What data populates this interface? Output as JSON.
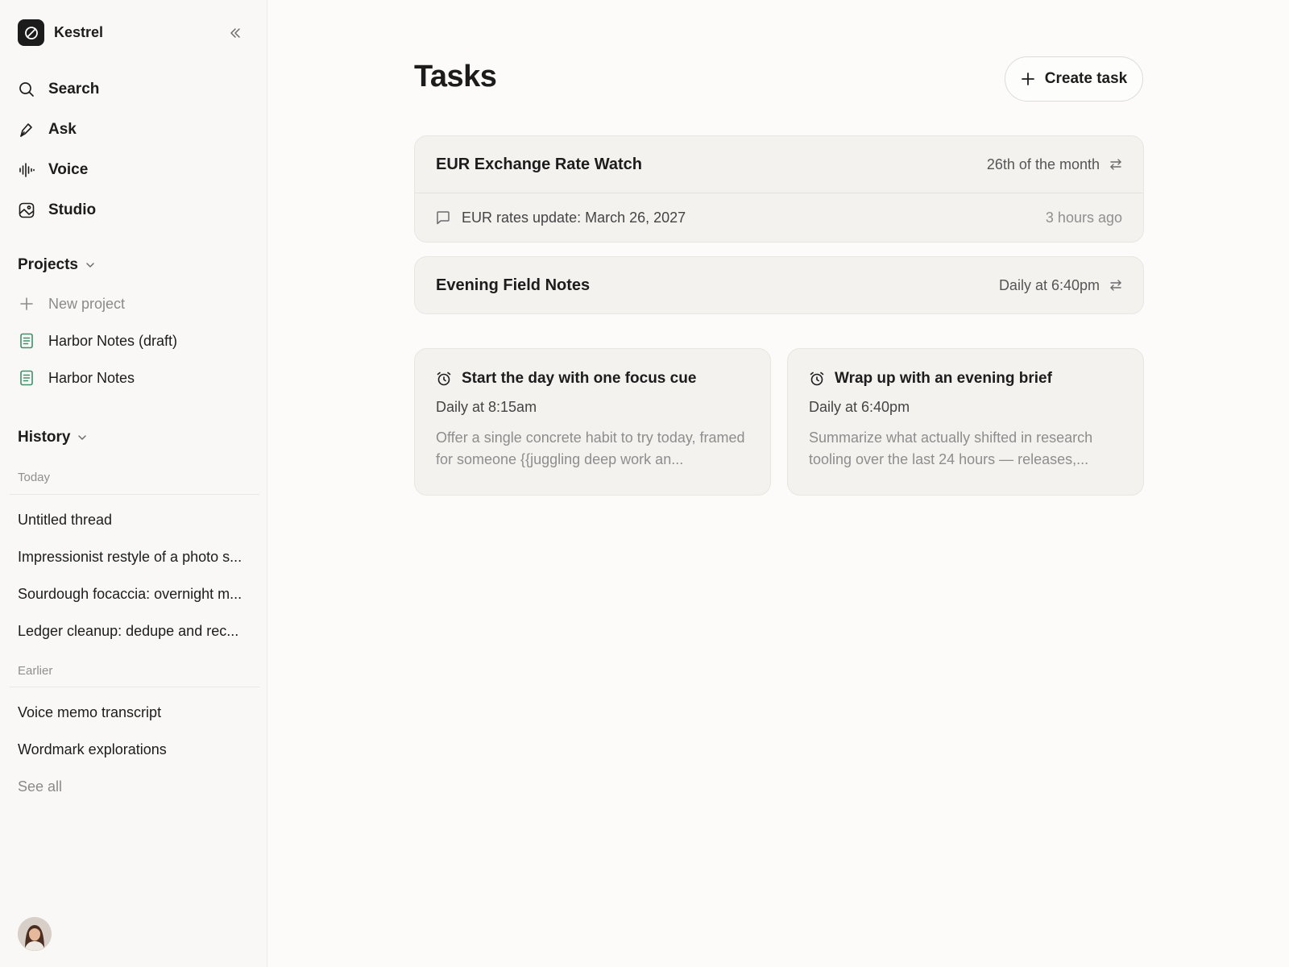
{
  "app": {
    "name": "Kestrel",
    "icons": {
      "logo": "slashed-circle-icon",
      "collapse": "chevrons-left-icon"
    }
  },
  "nav": [
    {
      "label": "Search",
      "icon": "search-icon"
    },
    {
      "label": "Ask",
      "icon": "pen-icon"
    },
    {
      "label": "Voice",
      "icon": "waveform-icon"
    },
    {
      "label": "Studio",
      "icon": "image-icon"
    }
  ],
  "projects": {
    "header": "Projects",
    "new_label": "New project",
    "items": [
      {
        "label": "Harbor Notes (draft)",
        "icon": "document-icon"
      },
      {
        "label": "Harbor Notes",
        "icon": "document-icon"
      }
    ]
  },
  "history": {
    "header": "History",
    "today_label": "Today",
    "today": [
      "Untitled thread",
      "Impressionist restyle of a photo s...",
      "Sourdough focaccia: overnight m...",
      "Ledger cleanup: dedupe and rec..."
    ],
    "earlier_label": "Earlier",
    "earlier": [
      "Voice memo transcript",
      "Wordmark explorations"
    ],
    "see_all": "See all"
  },
  "main": {
    "title": "Tasks",
    "create_label": "Create task",
    "tasks": [
      {
        "title": "EUR Exchange Rate Watch",
        "schedule": "26th of the month",
        "last_run": {
          "label": "EUR rates update: March 26, 2027",
          "time": "3 hours ago"
        }
      },
      {
        "title": "Evening Field Notes",
        "schedule": "Daily at 6:40pm"
      }
    ],
    "suggestions": [
      {
        "title": "Start the day with one focus cue",
        "schedule": "Daily at 8:15am",
        "description": "Offer a single concrete habit to try today, framed for someone {{juggling deep work an..."
      },
      {
        "title": "Wrap up with an evening brief",
        "schedule": "Daily at 6:40pm",
        "description": "Summarize what actually shifted in research tooling over the last 24 hours — releases,..."
      }
    ]
  },
  "colors": {
    "background": "#fcfbf9",
    "sidebar": "#f9f8f6",
    "card": "#f3f2ef",
    "text": "#1c1c1c",
    "muted": "#8d8d8d"
  }
}
